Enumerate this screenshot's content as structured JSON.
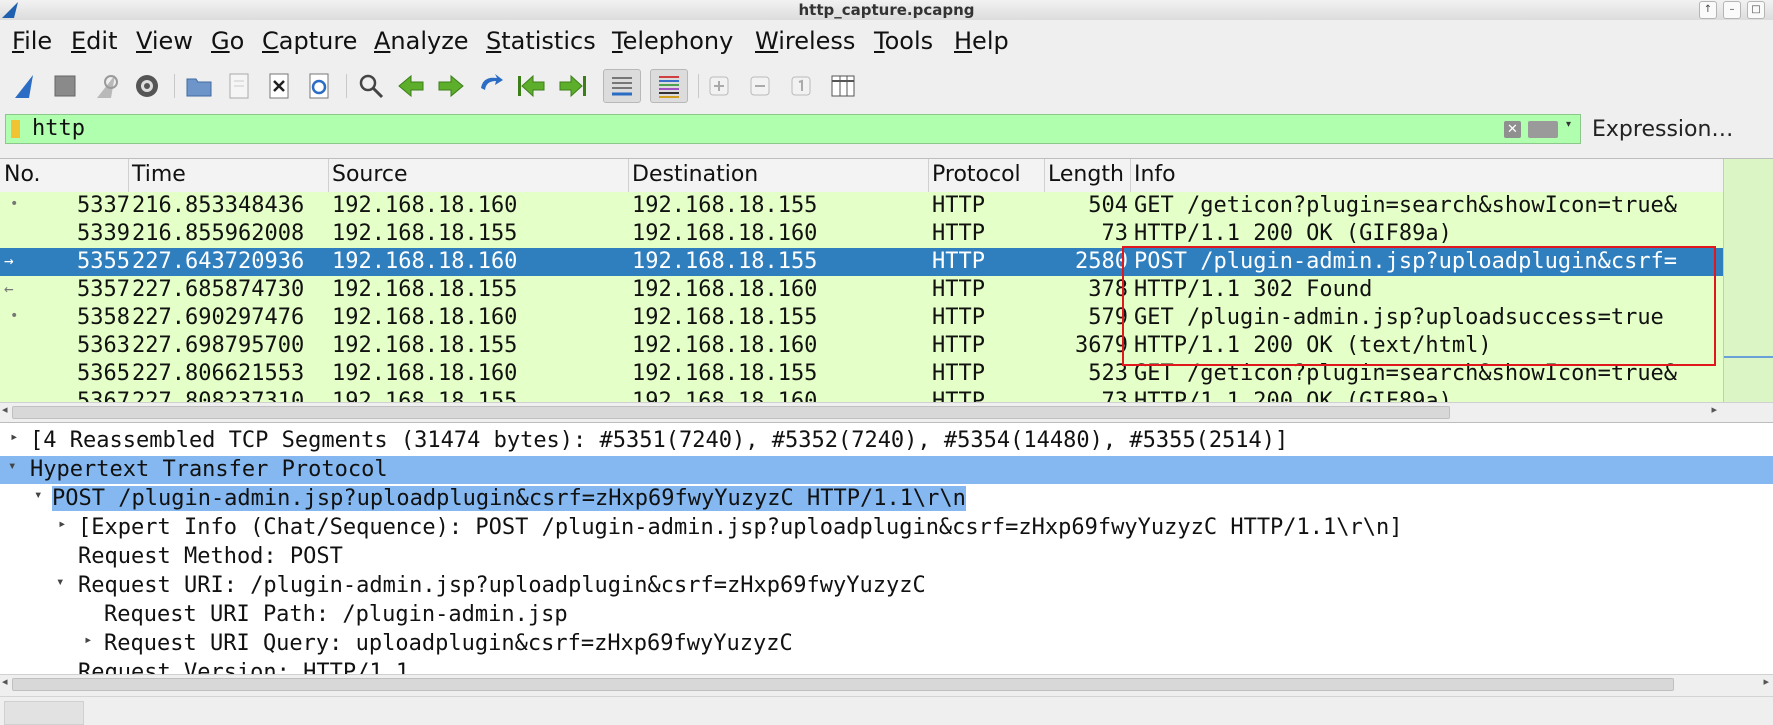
{
  "window": {
    "title": "http_capture.pcapng",
    "buttons": [
      "↑",
      "–",
      "□"
    ]
  },
  "menu": [
    "File",
    "Edit",
    "View",
    "Go",
    "Capture",
    "Analyze",
    "Statistics",
    "Telephony",
    "Wireless",
    "Tools",
    "Help"
  ],
  "toolbar": {
    "icons": [
      "start-capture-icon",
      "stop-capture-icon",
      "restart-capture-icon",
      "capture-options-icon",
      "open-file-icon",
      "save-file-icon",
      "close-file-icon",
      "reload-file-icon",
      "find-packet-icon",
      "go-back-icon",
      "go-forward-icon",
      "go-to-packet-icon",
      "go-first-icon",
      "go-last-icon",
      "auto-scroll-icon",
      "colorize-icon",
      "zoom-in-icon",
      "zoom-out-icon",
      "normal-size-icon",
      "resize-columns-icon"
    ]
  },
  "filter": {
    "value": "http",
    "expression_label": "Expression…"
  },
  "columns": [
    "No.",
    "Time",
    "Source",
    "Destination",
    "Protocol",
    "Length",
    "Info"
  ],
  "packets": [
    {
      "no": "5337",
      "time": "216.853348436",
      "src": "192.168.18.160",
      "dst": "192.168.18.155",
      "proto": "HTTP",
      "len": "504",
      "info": "GET /geticon?plugin=search&showIcon=true&"
    },
    {
      "no": "5339",
      "time": "216.855962008",
      "src": "192.168.18.155",
      "dst": "192.168.18.160",
      "proto": "HTTP",
      "len": "73",
      "info": "HTTP/1.1 200 OK  (GIF89a)"
    },
    {
      "no": "5355",
      "time": "227.643720936",
      "src": "192.168.18.160",
      "dst": "192.168.18.155",
      "proto": "HTTP",
      "len": "2580",
      "info": "POST /plugin-admin.jsp?uploadplugin&csrf="
    },
    {
      "no": "5357",
      "time": "227.685874730",
      "src": "192.168.18.155",
      "dst": "192.168.18.160",
      "proto": "HTTP",
      "len": "378",
      "info": "HTTP/1.1 302 Found"
    },
    {
      "no": "5358",
      "time": "227.690297476",
      "src": "192.168.18.160",
      "dst": "192.168.18.155",
      "proto": "HTTP",
      "len": "579",
      "info": "GET /plugin-admin.jsp?uploadsuccess=true"
    },
    {
      "no": "5363",
      "time": "227.698795700",
      "src": "192.168.18.155",
      "dst": "192.168.18.160",
      "proto": "HTTP",
      "len": "3679",
      "info": "HTTP/1.1 200 OK  (text/html)"
    },
    {
      "no": "5365",
      "time": "227.806621553",
      "src": "192.168.18.160",
      "dst": "192.168.18.155",
      "proto": "HTTP",
      "len": "523",
      "info": "GET /geticon?plugin=search&showIcon=true&"
    },
    {
      "no": "5367",
      "time": "227.808237310",
      "src": "192.168.18.155",
      "dst": "192.168.18.160",
      "proto": "HTTP",
      "len": "73",
      "info": "HTTP/1.1 200 OK  (GIF89a)"
    }
  ],
  "selected_packet": "5355",
  "details": [
    {
      "text": "[4 Reassembled TCP Segments (31474 bytes): #5351(7240), #5352(7240), #5354(14480), #5355(2514)]",
      "arrow": "▸",
      "level": 0
    },
    {
      "text": "Hypertext Transfer Protocol",
      "arrow": "▾",
      "level": 0,
      "highlight": "row"
    },
    {
      "text": "POST /plugin-admin.jsp?uploadplugin&csrf=zHxp69fwyYuzyzC HTTP/1.1\\r\\n",
      "arrow": "▾",
      "level": 1,
      "highlight": "text"
    },
    {
      "text": "[Expert Info (Chat/Sequence): POST /plugin-admin.jsp?uploadplugin&csrf=zHxp69fwyYuzyzC HTTP/1.1\\r\\n]",
      "arrow": "▸",
      "level": 2
    },
    {
      "text": "Request Method: POST",
      "arrow": "",
      "level": 2
    },
    {
      "text": "Request URI: /plugin-admin.jsp?uploadplugin&csrf=zHxp69fwyYuzyzC",
      "arrow": "▾",
      "level": 2
    },
    {
      "text": "Request URI Path: /plugin-admin.jsp",
      "arrow": "",
      "level": 3
    },
    {
      "text": "Request URI Query: uploadplugin&csrf=zHxp69fwyYuzyzC",
      "arrow": "▸",
      "level": 3
    },
    {
      "text": "Request Version: HTTP/1.1",
      "arrow": "",
      "level": 2
    }
  ],
  "colors": {
    "row_bg": "#e4ffc7",
    "selected_bg": "#2f7fbf",
    "filter_bg": "#afffaf",
    "details_highlight": "#85b8f0",
    "annotation": "#e0181e"
  }
}
